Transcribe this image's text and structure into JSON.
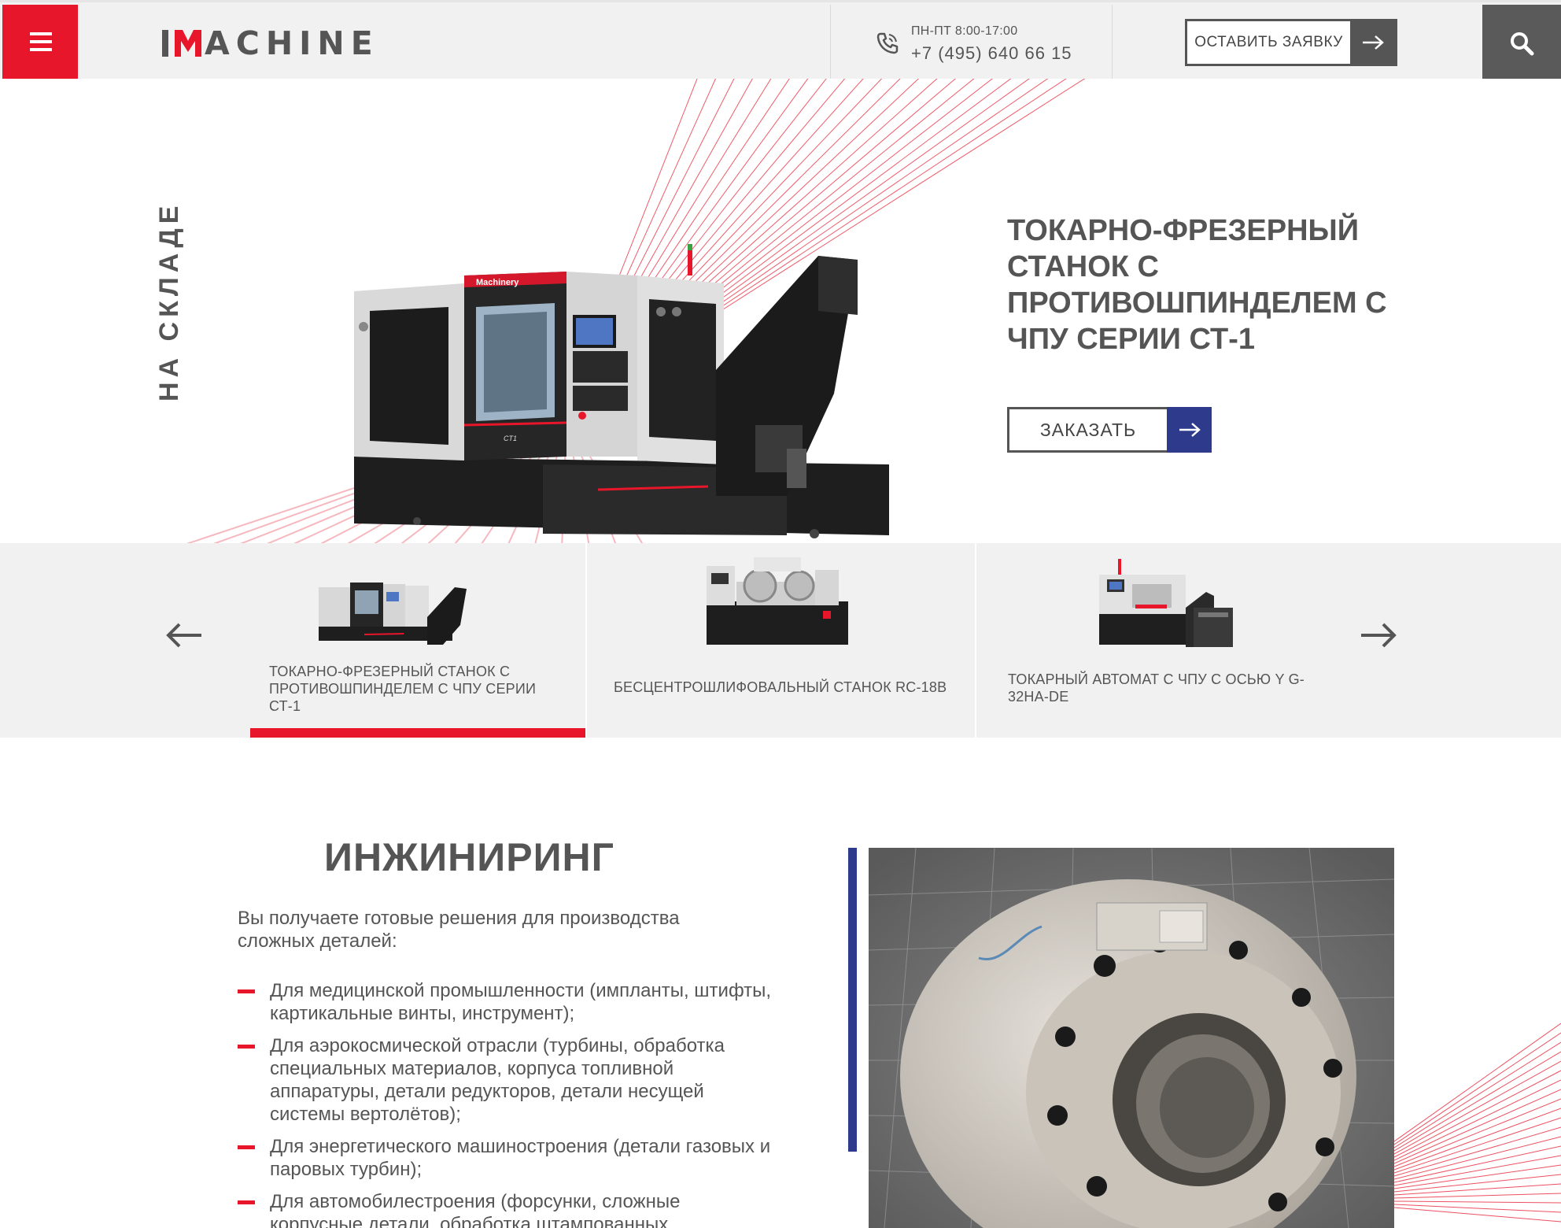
{
  "header": {
    "logo_text": "IMACHINE",
    "hours": "ПН-ПТ 8:00-17:00",
    "phone": "+7 (495) 640 66 15",
    "cta_label": "ОСТАВИТЬ ЗАЯВКУ"
  },
  "hero": {
    "stock_label": "НА СКЛАДЕ",
    "title": "ТОКАРНО-ФРЕЗЕРНЫЙ СТАНОК С ПРОТИВОШПИНДЕЛЕМ С ЧПУ СЕРИИ СТ-1",
    "order_label": "ЗАКАЗАТЬ",
    "machine_brand": "Machinery",
    "machine_model": "CT1"
  },
  "carousel": {
    "items": [
      {
        "caption": "ТОКАРНО-ФРЕЗЕРНЫЙ СТАНОК С ПРОТИВОШПИНДЕЛЕМ С ЧПУ СЕРИИ СТ-1",
        "active": true
      },
      {
        "caption": "БЕСЦЕНТРОШЛИФОВАЛЬНЫЙ СТАНОК RC-18B",
        "active": false
      },
      {
        "caption": "ТОКАРНЫЙ АВТОМАТ С ЧПУ С ОСЬЮ Y G-32HA-DE",
        "active": false
      }
    ]
  },
  "engineering": {
    "title": "ИНЖИНИРИНГ",
    "intro": "Вы получаете готовые решения для производства сложных деталей:",
    "items": [
      "Для медицинской промышленности (импланты, штифты, картикальные винты, инструмент);",
      "Для аэрокосмической отрасли (турбины, обработка специальных материалов, корпуса топливной аппаратуры, детали редукторов, детали несущей системы вертолётов);",
      "Для энергетического машиностроения (детали газовых и паровых турбин);",
      "Для автомобилестроения (форсунки, сложные корпусные детали, обработка штампованных"
    ]
  },
  "colors": {
    "brand_red": "#e8162b",
    "accent_blue": "#2e3a8c",
    "dark_gray": "#555555",
    "panel_gray": "#f1f1f1"
  },
  "icons": [
    "menu-icon",
    "phone-icon",
    "arrow-right-icon",
    "search-icon",
    "arrow-left-icon"
  ]
}
